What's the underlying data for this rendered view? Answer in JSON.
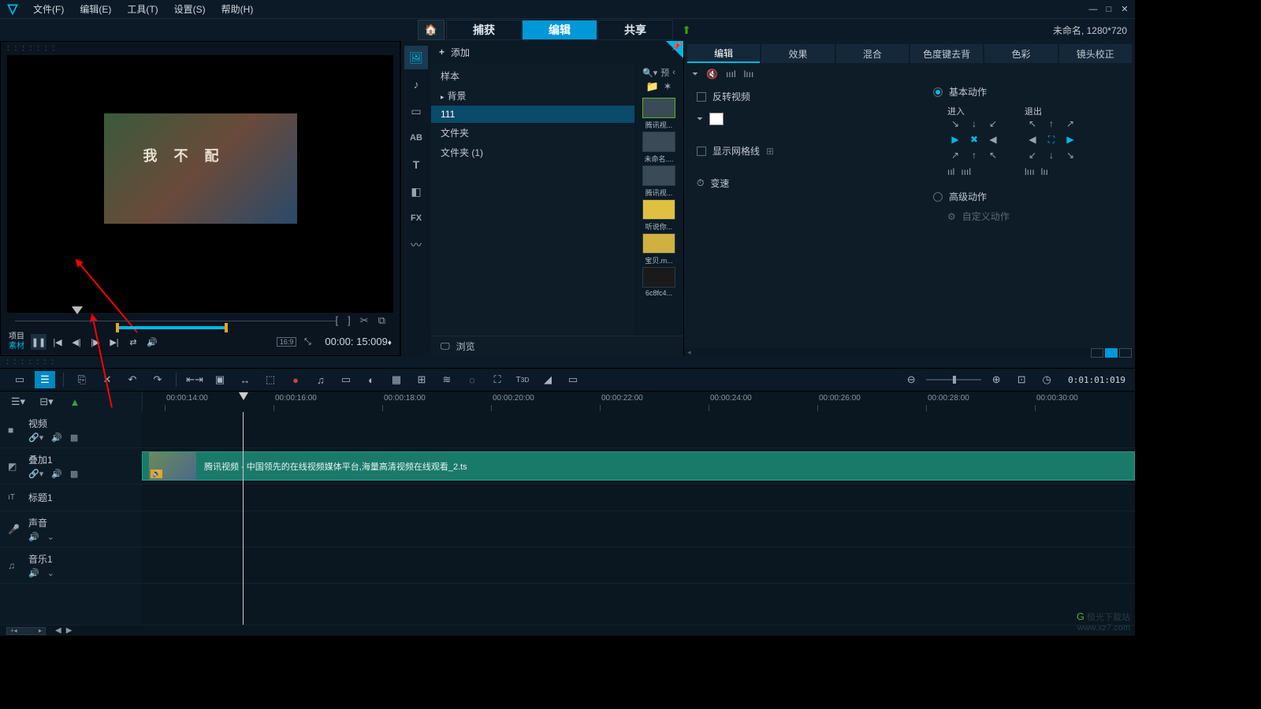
{
  "app": {
    "title_suffix": "未命名, 1280*720"
  },
  "menu": {
    "file": "文件(F)",
    "edit": "编辑(E)",
    "tools": "工具(T)",
    "settings": "设置(S)",
    "help": "帮助(H)"
  },
  "modes": {
    "capture": "捕获",
    "edit": "编辑",
    "share": "共享"
  },
  "preview": {
    "project_label": "项目",
    "material_label": "素材",
    "aspect": "16:9",
    "timecode": "00:00: 15:009",
    "timecode_frames": "♦"
  },
  "library": {
    "add": "添加",
    "search_prefix": "预",
    "folders": {
      "sample": "样本",
      "background": "背景",
      "f111": "111",
      "folder": "文件夹",
      "folder1": "文件夹 (1)"
    },
    "thumbs": [
      {
        "label": "腾讯视..."
      },
      {
        "label": "未命名...."
      },
      {
        "label": "腾讯视..."
      },
      {
        "label": "听说你..."
      },
      {
        "label": "宝贝.m..."
      },
      {
        "label": "6c8fc4..."
      }
    ],
    "browse": "浏览"
  },
  "options": {
    "tabs": {
      "edit": "编辑",
      "effect": "效果",
      "blend": "混合",
      "chroma": "色度键去背",
      "color": "色彩",
      "lens": "镜头校正"
    },
    "reverse_video": "反转视频",
    "show_grid": "显示网格线",
    "speed": "变速",
    "basic_motion": "基本动作",
    "enter": "进入",
    "exit": "退出",
    "advanced_motion": "高级动作",
    "custom_motion": "自定义动作"
  },
  "timeline": {
    "toolbar_tc": "0:01:01:019",
    "ruler": [
      "00:00:14:00",
      "00:00:16:00",
      "00:00:18:00",
      "00:00:20:00",
      "00:00:22:00",
      "00:00:24:00",
      "00:00:26:00",
      "00:00:28:00",
      "00:00:30:00"
    ],
    "tracks": {
      "video": "视频",
      "overlay1": "叠加1",
      "title1": "标题1",
      "voice": "声音",
      "music1": "音乐1"
    },
    "clip_label": "腾讯视频 - 中国领先的在线视频媒体平台,海量高清视频在线观看_2.ts"
  },
  "watermark": {
    "name": "极光下载站",
    "url": "www.xz7.com"
  }
}
